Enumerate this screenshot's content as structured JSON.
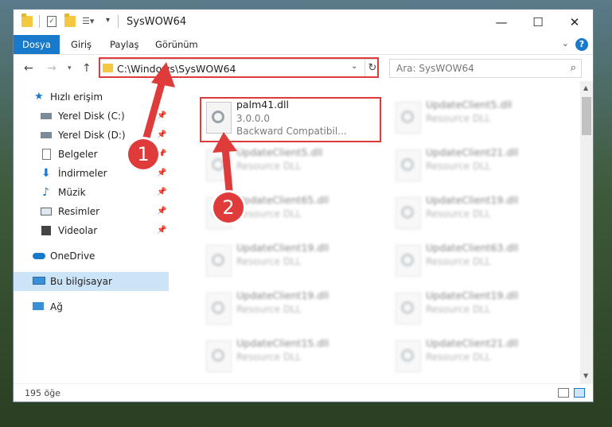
{
  "title_bar": {
    "title": "SysWOW64",
    "minimize": "—",
    "maximize": "☐",
    "close": "✕"
  },
  "ribbon": {
    "tabs": [
      "Dosya",
      "Giriş",
      "Paylaş",
      "Görünüm"
    ],
    "help": "?"
  },
  "address_bar": {
    "path": "C:\\Windows\\SysWOW64",
    "search_placeholder": "Ara: SysWOW64"
  },
  "sidebar": {
    "items": [
      {
        "label": "Hızlı erişim",
        "icon": "star-icon",
        "pinned": false
      },
      {
        "label": "Yerel Disk (C:)",
        "icon": "drive-icon",
        "pinned": true
      },
      {
        "label": "Yerel Disk (D:)",
        "icon": "drive-icon",
        "pinned": true
      },
      {
        "label": "Belgeler",
        "icon": "document-icon",
        "pinned": true
      },
      {
        "label": "İndirmeler",
        "icon": "download-icon",
        "pinned": true
      },
      {
        "label": "Müzik",
        "icon": "music-icon",
        "pinned": true
      },
      {
        "label": "Resimler",
        "icon": "pictures-icon",
        "pinned": true
      },
      {
        "label": "Videolar",
        "icon": "video-icon",
        "pinned": true
      },
      {
        "label": "OneDrive",
        "icon": "cloud-icon",
        "pinned": false
      },
      {
        "label": "Bu bilgisayar",
        "icon": "computer-icon",
        "pinned": false
      },
      {
        "label": "Ağ",
        "icon": "network-icon",
        "pinned": false
      }
    ]
  },
  "files": {
    "highlighted": {
      "name": "palm41.dll",
      "version": "3.0.0.0",
      "description": "Backward Compatibil..."
    },
    "left_column": [
      {
        "name": "UpdateClient5.dll",
        "description": "Resource DLL"
      },
      {
        "name": "UpdateClient65.dll",
        "description": "Resource DLL"
      },
      {
        "name": "UpdateClient19.dll",
        "description": "Resource DLL"
      },
      {
        "name": "UpdateClient19.dll",
        "description": "Resource DLL"
      },
      {
        "name": "UpdateClient15.dll",
        "description": "Resource DLL"
      }
    ],
    "right_column": [
      {
        "name": "UpdateClient5.dll",
        "description": "Resource DLL"
      },
      {
        "name": "UpdateClient21.dll",
        "description": "Resource DLL"
      },
      {
        "name": "UpdateClient19.dll",
        "description": "Resource DLL"
      },
      {
        "name": "UpdateClient63.dll",
        "description": "Resource DLL"
      },
      {
        "name": "UpdateClient19.dll",
        "description": "Resource DLL"
      },
      {
        "name": "UpdateClient21.dll",
        "description": "Resource DLL"
      }
    ]
  },
  "status_bar": {
    "item_count": "195 öğe"
  },
  "annotations": {
    "step1": "1",
    "step2": "2",
    "color": "#e03b3b"
  }
}
